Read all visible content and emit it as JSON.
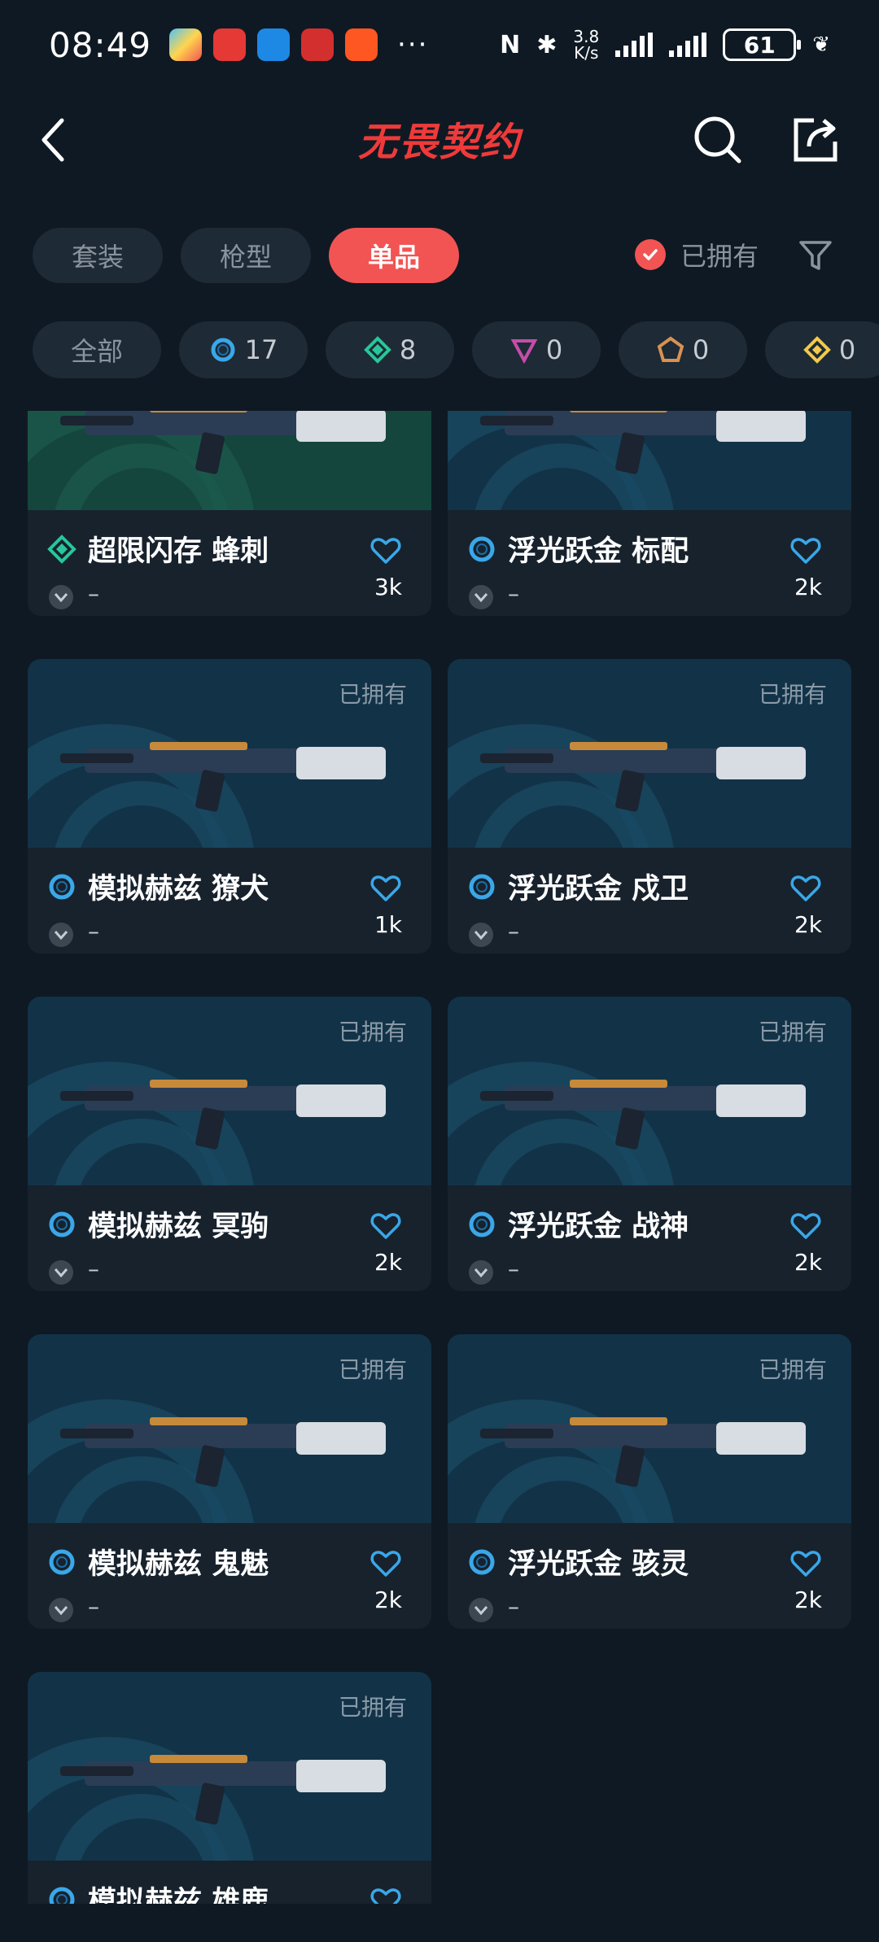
{
  "status_bar": {
    "time": "08:49",
    "net_speed_value": "3.8",
    "net_speed_unit": "K/s",
    "battery": "61"
  },
  "header": {
    "title": "无畏契约"
  },
  "tabs": [
    {
      "label": "套装",
      "active": false
    },
    {
      "label": "枪型",
      "active": false
    },
    {
      "label": "单品",
      "active": true
    }
  ],
  "owned_filter": {
    "label": "已拥有",
    "checked": true
  },
  "chips": [
    {
      "label": "全部",
      "icon": "",
      "count": ""
    },
    {
      "label": "",
      "icon": "blue-ring-tier-icon",
      "count": "17",
      "color": "#3aa7e8"
    },
    {
      "label": "",
      "icon": "green-diamond-tier-icon",
      "count": "8",
      "color": "#27c79a"
    },
    {
      "label": "",
      "icon": "pink-triangle-tier-icon",
      "count": "0",
      "color": "#c44ea8"
    },
    {
      "label": "",
      "icon": "orange-pentagon-tier-icon",
      "count": "0",
      "color": "#d89252"
    },
    {
      "label": "",
      "icon": "gold-diamond-tier-icon",
      "count": "0",
      "color": "#f2c94c"
    }
  ],
  "cards": [
    {
      "name": "超限闪存 蜂刺",
      "tier": "green",
      "likes": "3k",
      "owned": false,
      "meta": "–",
      "bg": "green"
    },
    {
      "name": "浮光跃金 标配",
      "tier": "blue",
      "likes": "2k",
      "owned": false,
      "meta": "–",
      "bg": "blue"
    },
    {
      "name": "模拟赫兹 獠犬",
      "tier": "blue",
      "likes": "1k",
      "owned": true,
      "meta": "–",
      "bg": "blue"
    },
    {
      "name": "浮光跃金 戍卫",
      "tier": "blue",
      "likes": "2k",
      "owned": true,
      "meta": "–",
      "bg": "blue"
    },
    {
      "name": "模拟赫兹 冥驹",
      "tier": "blue",
      "likes": "2k",
      "owned": true,
      "meta": "–",
      "bg": "blue"
    },
    {
      "name": "浮光跃金 战神",
      "tier": "blue",
      "likes": "2k",
      "owned": true,
      "meta": "–",
      "bg": "blue"
    },
    {
      "name": "模拟赫兹 鬼魅",
      "tier": "blue",
      "likes": "2k",
      "owned": true,
      "meta": "–",
      "bg": "blue"
    },
    {
      "name": "浮光跃金 骇灵",
      "tier": "blue",
      "likes": "2k",
      "owned": true,
      "meta": "–",
      "bg": "blue"
    },
    {
      "name": "模拟赫兹 雄鹿",
      "tier": "blue",
      "likes": "",
      "owned": true,
      "meta": "",
      "bg": "blue"
    }
  ],
  "owned_tag_label": "已拥有",
  "colors": {
    "accent": "#f25454",
    "background": "#0f1923",
    "card": "#17222d",
    "chip": "#1e2a35",
    "heart": "#3aa7e8"
  }
}
